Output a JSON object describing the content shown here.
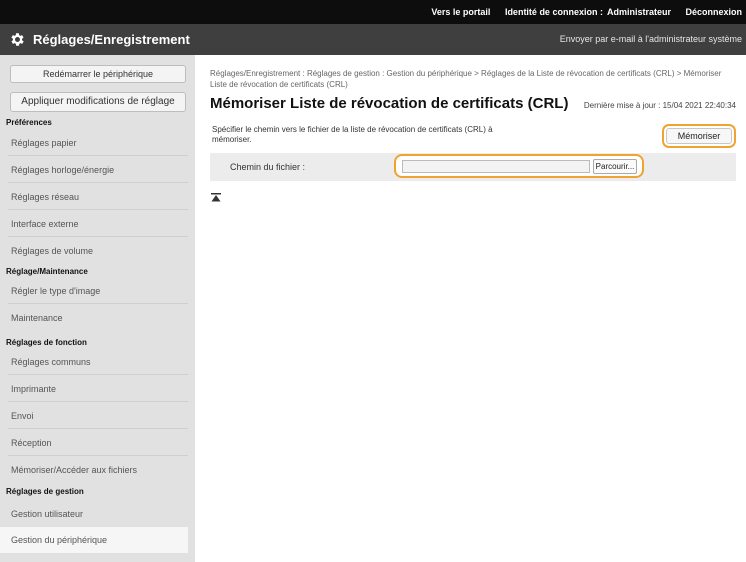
{
  "topbar": {
    "portal_link": "Vers le portail",
    "login_id_label": "Identité de connexion :",
    "user": "Administrateur",
    "logout": "Déconnexion"
  },
  "header": {
    "title": "Réglages/Enregistrement",
    "email_link": "Envoyer par e-mail à l'administrateur système"
  },
  "sidebar": {
    "restart_button": "Redémarrer le périphérique",
    "apply_button": "Appliquer modifications de réglage",
    "sections": [
      {
        "heading": "Préférences",
        "items": [
          "Réglages papier",
          "Réglages horloge/énergie",
          "Réglages réseau",
          "Interface externe",
          "Réglages de volume"
        ]
      },
      {
        "heading": "Réglage/Maintenance",
        "items": [
          "Régler le type d'image",
          "Maintenance"
        ]
      },
      {
        "heading": "Réglages de fonction",
        "items": [
          "Réglages communs",
          "Imprimante",
          "Envoi",
          "Réception",
          "Mémoriser/Accéder aux fichiers"
        ]
      },
      {
        "heading": "Réglages de gestion",
        "items": [
          "Gestion utilisateur",
          "Gestion du périphérique"
        ]
      }
    ],
    "selected_item": "Gestion du périphérique"
  },
  "main": {
    "breadcrumb": "Réglages/Enregistrement : Réglages de gestion : Gestion du périphérique > Réglages de la Liste de révocation de certificats (CRL) > Mémoriser Liste de révocation de certificats (CRL)",
    "title": "Mémoriser Liste de révocation de certificats (CRL)",
    "last_update": "Dernière mise à jour : 15/04 2021 22:40:34",
    "description": "Spécifier le chemin vers le fichier de la liste de révocation de certificats (CRL) à mémoriser.",
    "memoriser_button": "Mémoriser",
    "file_path_label": "Chemin du fichier :",
    "file_path_value": "",
    "browse_button": "Parcourir..."
  },
  "icons": {
    "header": "gear-icon",
    "back_to_top": "back-to-top-icon"
  },
  "colors": {
    "highlight": "#f0a330",
    "topbar": "#0d0d0d",
    "header": "#3f3f3f",
    "sidebar": "#e1e1e1"
  }
}
